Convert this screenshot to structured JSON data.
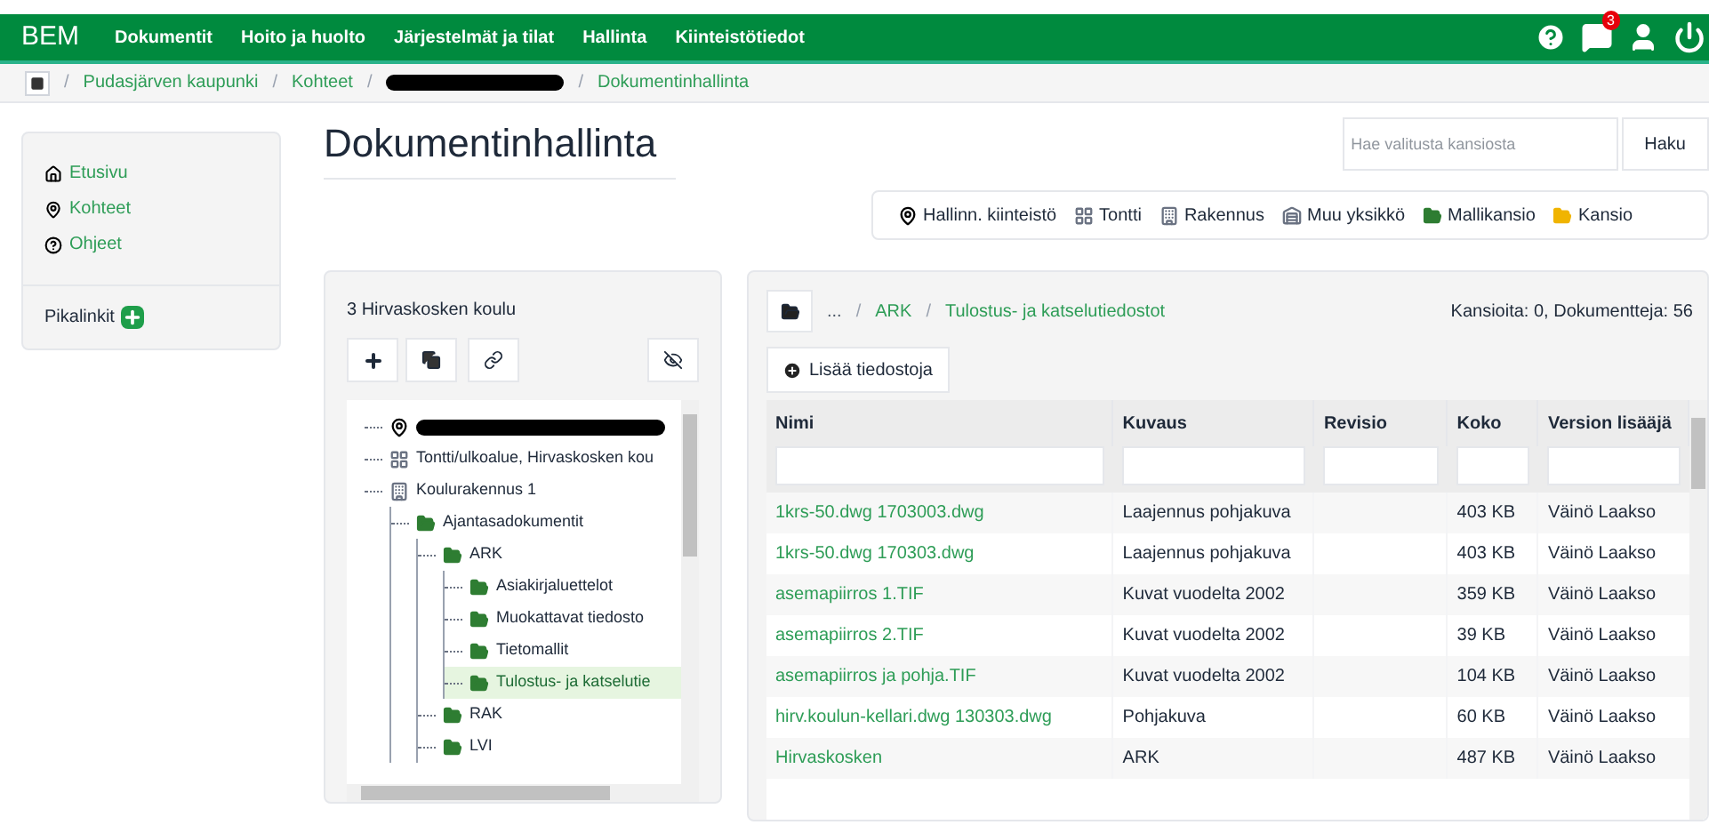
{
  "navbar": {
    "brand": "BEM",
    "items": [
      "Dokumentit",
      "Hoito ja huolto",
      "Järjestelmät ja tilat",
      "Hallinta",
      "Kiinteistötiedot"
    ],
    "notification_count": "3"
  },
  "breadcrumb": {
    "separator": "/",
    "items": [
      {
        "kind": "link",
        "label": "Pudasjärven kaupunki"
      },
      {
        "kind": "link",
        "label": "Kohteet"
      },
      {
        "kind": "redacted"
      },
      {
        "kind": "link",
        "label": "Dokumentinhallinta"
      }
    ]
  },
  "sidebar": {
    "items": [
      {
        "kind": "home",
        "label": "Etusivu"
      },
      {
        "kind": "pin",
        "label": "Kohteet"
      },
      {
        "kind": "help",
        "label": "Ohjeet"
      }
    ],
    "quicklinks": "Pikalinkit"
  },
  "page_title": "Dokumentinhallinta",
  "search": {
    "placeholder": "Hae valitusta kansiosta",
    "button": "Haku"
  },
  "legend": [
    {
      "kind": "pin",
      "label": "Hallinn. kiinteistö"
    },
    {
      "kind": "grid",
      "label": "Tontti"
    },
    {
      "kind": "building",
      "label": "Rakennus"
    },
    {
      "kind": "unit",
      "label": "Muu yksikkö"
    },
    {
      "kind": "folder",
      "color": "#2e7d32",
      "label": "Mallikansio"
    },
    {
      "kind": "folder",
      "color": "#f0b400",
      "label": "Kansio"
    }
  ],
  "tree": {
    "title": "3 Hirvaskosken koulu",
    "nodes": [
      {
        "kind": "pin",
        "selected": false
      },
      {
        "kind": "grid",
        "label": "Tontti/ulkoalue, Hirvaskosken kou",
        "selected": false
      },
      {
        "kind": "building",
        "label": "Koulurakennus 1",
        "selected": false,
        "children": [
          {
            "kind": "folder",
            "label": "Ajantasadokumentit",
            "selected": false,
            "children": [
              {
                "kind": "folder",
                "label": "ARK",
                "selected": false,
                "children": [
                  {
                    "kind": "folder",
                    "label": "Asiakirjaluettelot",
                    "selected": false
                  },
                  {
                    "kind": "folder",
                    "label": "Muokattavat tiedosto",
                    "selected": false
                  },
                  {
                    "kind": "folder",
                    "label": "Tietomallit",
                    "selected": false
                  },
                  {
                    "kind": "folder",
                    "label": "Tulostus- ja katselutie",
                    "selected": true
                  }
                ]
              },
              {
                "kind": "folder",
                "label": "RAK",
                "selected": false
              },
              {
                "kind": "folder",
                "label": "LVI",
                "selected": false
              }
            ]
          }
        ]
      }
    ]
  },
  "files": {
    "separator": "/",
    "path": [
      "...",
      "ARK",
      "Tulostus- ja katselutiedostot"
    ],
    "summary": "Kansioita: 0, Dokumentteja: 56",
    "add_button": "Lisää tiedostoja",
    "columns": [
      "Nimi",
      "Kuvaus",
      "Revisio",
      "Koko",
      "Version lisääjä"
    ],
    "rows": [
      {
        "name": "1krs-50.dwg 1703003.dwg",
        "description": "Laajennus pohjakuva",
        "size": "403 KB",
        "added_by": "Väinö Laakso"
      },
      {
        "name": "1krs-50.dwg 170303.dwg",
        "description": "Laajennus pohjakuva",
        "size": "403 KB",
        "added_by": "Väinö Laakso"
      },
      {
        "name": "asemapiirros 1.TIF",
        "description": "Kuvat vuodelta 2002",
        "size": "359 KB",
        "added_by": "Väinö Laakso"
      },
      {
        "name": "asemapiirros 2.TIF",
        "description": "Kuvat vuodelta 2002",
        "size": "39 KB",
        "added_by": "Väinö Laakso"
      },
      {
        "name": "asemapiirros ja pohja.TIF",
        "description": "Kuvat vuodelta 2002",
        "size": "104 KB",
        "added_by": "Väinö Laakso"
      },
      {
        "name": "hirv.koulun-kellari.dwg 130303.dwg",
        "description": "Pohjakuva",
        "size": "60 KB",
        "added_by": "Väinö Laakso"
      },
      {
        "name": "Hirvaskosken",
        "description": "ARK",
        "size": "487 KB",
        "added_by": "Väinö Laakso"
      }
    ]
  }
}
